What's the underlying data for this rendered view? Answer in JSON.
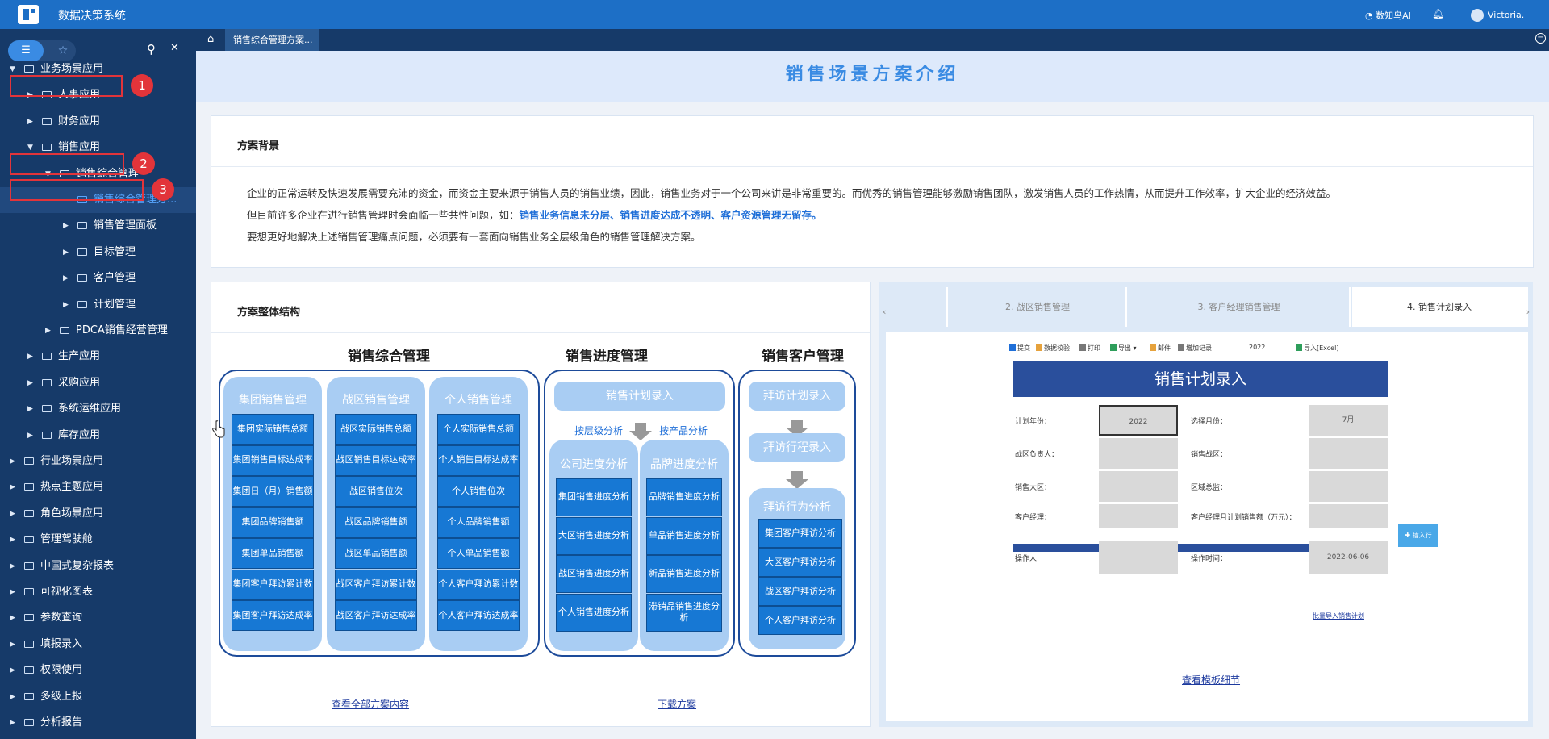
{
  "topbar": {
    "title": "数据决策系统",
    "ai": "数知鸟AI",
    "user": "Victoria."
  },
  "sidebar": {
    "items": [
      {
        "label": "业务场景应用",
        "icon": "folder-icon"
      },
      {
        "label": "人事应用",
        "icon": "people-icon"
      },
      {
        "label": "财务应用",
        "icon": "calculator-icon"
      },
      {
        "label": "销售应用",
        "icon": "cart-icon"
      },
      {
        "label": "销售综合管理",
        "icon": "folder-icon"
      },
      {
        "label": "销售综合管理方...",
        "icon": "report-icon"
      },
      {
        "label": "销售管理面板",
        "icon": "folder-icon"
      },
      {
        "label": "目标管理",
        "icon": "folder-icon"
      },
      {
        "label": "客户管理",
        "icon": "folder-icon"
      },
      {
        "label": "计划管理",
        "icon": "folder-icon"
      },
      {
        "label": "PDCA销售经营管理",
        "icon": "folder-icon"
      },
      {
        "label": "生产应用",
        "icon": "chart-icon"
      },
      {
        "label": "采购应用",
        "icon": "cart-icon"
      },
      {
        "label": "系统运维应用",
        "icon": "monitor-icon"
      },
      {
        "label": "库存应用",
        "icon": "box-icon"
      },
      {
        "label": "行业场景应用",
        "icon": "folder-icon"
      },
      {
        "label": "热点主题应用",
        "icon": "folder-icon"
      },
      {
        "label": "角色场景应用",
        "icon": "folder-icon"
      },
      {
        "label": "管理驾驶舱",
        "icon": "folder-icon"
      },
      {
        "label": "中国式复杂报表",
        "icon": "folder-icon"
      },
      {
        "label": "可视化图表",
        "icon": "folder-icon"
      },
      {
        "label": "参数查询",
        "icon": "folder-icon"
      },
      {
        "label": "填报录入",
        "icon": "folder-icon"
      },
      {
        "label": "权限使用",
        "icon": "folder-icon"
      },
      {
        "label": "多级上报",
        "icon": "folder-icon"
      },
      {
        "label": "分析报告",
        "icon": "folder-icon"
      }
    ],
    "markers": [
      "1",
      "2",
      "3"
    ]
  },
  "tabbar": {
    "tab": "销售综合管理方案..."
  },
  "banner": {
    "title": "销售场景方案介绍"
  },
  "background": {
    "title": "方案背景",
    "p1": "企业的正常运转及快速发展需要充沛的资金，而资金主要来源于销售人员的销售业绩，因此，销售业务对于一个公司来讲是非常重要的。而优秀的销售管理能够激励销售团队，激发销售人员的工作热情，从而提升工作效率，扩大企业的经济效益。",
    "p2a": "但目前许多企业在进行销售管理时会面临一些共性问题，如：",
    "p2b": "销售业务信息未分层、销售进度达成不透明、客户资源管理无留存。",
    "p3": "要想更好地解决上述销售管理痛点问题，必须要有一套面向销售业务全层级角色的销售管理解决方案。"
  },
  "structure": {
    "title": "方案整体结构",
    "s1": {
      "title": "销售综合管理",
      "cols": [
        {
          "head": "集团销售管理",
          "cells": [
            "集团实际销售总额",
            "集团销售目标达成率",
            "集团日（月）销售额",
            "集团品牌销售额",
            "集团单品销售额",
            "集团客户拜访累计数",
            "集团客户拜访达成率"
          ]
        },
        {
          "head": "战区销售管理",
          "cells": [
            "战区实际销售总额",
            "战区销售目标达成率",
            "战区销售位次",
            "战区品牌销售额",
            "战区单品销售额",
            "战区客户拜访累计数",
            "战区客户拜访达成率"
          ]
        },
        {
          "head": "个人销售管理",
          "cells": [
            "个人实际销售总额",
            "个人销售目标达成率",
            "个人销售位次",
            "个人品牌销售额",
            "个人单品销售额",
            "个人客户拜访累计数",
            "个人客户拜访达成率"
          ]
        }
      ]
    },
    "s2": {
      "title": "销售进度管理",
      "top": "销售计划录入",
      "left_label": "按层级分析",
      "right_label": "按产品分析",
      "cols": [
        {
          "head": "公司进度分析",
          "cells": [
            "集团销售进度分析",
            "大区销售进度分析",
            "战区销售进度分析",
            "个人销售进度分析"
          ]
        },
        {
          "head": "品牌进度分析",
          "cells": [
            "品牌销售进度分析",
            "单品销售进度分析",
            "新品销售进度分析",
            "滞销品销售进度分析"
          ]
        }
      ]
    },
    "s3": {
      "title": "销售客户管理",
      "steps": [
        "拜访计划录入",
        "拜访行程录入"
      ],
      "col": {
        "head": "拜访行为分析",
        "cells": [
          "集团客户拜访分析",
          "大区客户拜访分析",
          "战区客户拜访分析",
          "个人客户拜访分析"
        ]
      }
    },
    "link_all": "查看全部方案内容",
    "link_download": "下载方案"
  },
  "preview": {
    "tabs": [
      "2. 战区销售管理",
      "3. 客户经理销售管理",
      "4. 销售计划录入"
    ],
    "toolbar": [
      "提交",
      "数据校验",
      "打印",
      "导出",
      "邮件",
      "增加记录",
      "2022",
      "导入[Excel]"
    ],
    "form_title": "销售计划录入",
    "fields": {
      "year_label": "计划年份：",
      "year_value": "2022",
      "month_label": "选择月份：",
      "month_value": "7月",
      "zone_owner": "战区负责人：",
      "zone": "销售战区：",
      "region": "销售大区：",
      "region_head": "区域总监：",
      "manager": "客户经理：",
      "manager_amount": "客户经理月计划销售额（万元）：",
      "operator": "操作人",
      "op_time_label": "操作时间：",
      "op_time": "2022-06-06"
    },
    "insert": "插入行",
    "batch": "批量导入销售计划",
    "detail_link": "查看模板细节"
  }
}
